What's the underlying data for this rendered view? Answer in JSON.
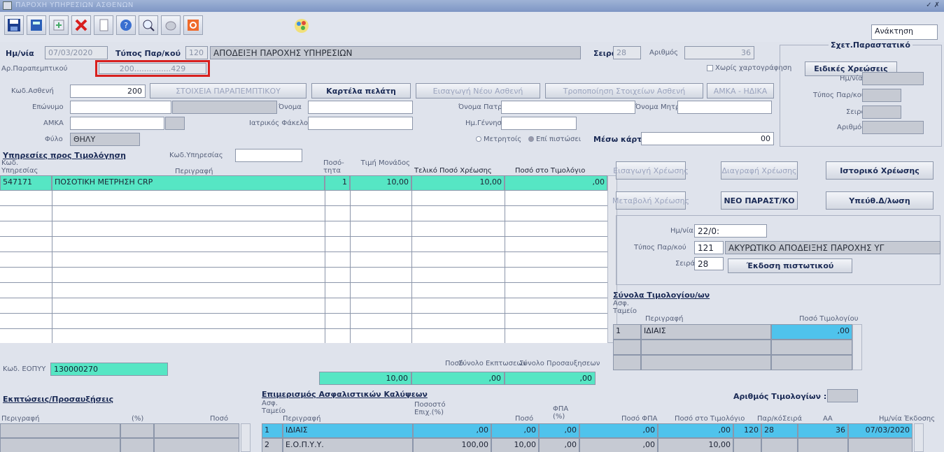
{
  "window": {
    "title": "ΠΑΡΟΧΗ ΥΠΗΡΕΣΙΩΝ ΑΣΘΕΝΩΝ"
  },
  "toolbar": {
    "icons": [
      "save-icon",
      "print-icon",
      "export-icon",
      "delete-icon",
      "new-document-icon",
      "help-icon",
      "zoom-icon",
      "clear-icon",
      "exit-icon",
      "palette-icon"
    ],
    "mode": "Ανάκτηση"
  },
  "header": {
    "date_label": "Ημ/νία",
    "date": "07/03/2020",
    "type_label": "Τύπος Παρ/κού",
    "type_code": "120",
    "type_desc": "ΑΠΟΔΕΙΞΗ ΠΑΡΟΧΗΣ ΥΠΗΡΕΣΙΩΝ",
    "series_label": "Σειρά",
    "series": "28",
    "number_label": "Αριθμός",
    "number": "36",
    "referral_label": "Αρ.Παραπεμπτικού",
    "referral": "200...............429",
    "checkbox_label": "Χωρίς χαρτογράφηση",
    "special_charges": "Ειδικές Χρεώσεις"
  },
  "patient": {
    "code_label": "Κωδ.Ασθενή",
    "code": "200",
    "btn_referral": "ΣΤΟΙΧΕΙΑ ΠΑΡΑΠΕΜΠΤΙΚΟΥ",
    "btn_card": "Καρτέλα πελάτη",
    "btn_new": "Εισαγωγή Νέου Ασθενή",
    "btn_edit": "Τροποποίηση Στοιχείων Ασθενή",
    "btn_amka": "ΑΜΚΑ - ΗΔΙΚΑ",
    "surname_label": "Επώνυμο",
    "name_label": "Όνομα",
    "father_label": "Όνομα Πατρός",
    "mother_label": "Όνομα Μητρός",
    "amka_label": "ΑΜΚΑ",
    "file_label": "Ιατρικός Φάκελος",
    "birth_label": "Ημ.Γέννησης",
    "gender_label": "Φύλο",
    "gender": "ΘΗΛΥ",
    "radio1": "Μετρητοίς",
    "radio2": "Επί πιστώσει",
    "card_label": "Μέσω κάρτας",
    "card_value": "00"
  },
  "related": {
    "title": "Σχετ.Παραστατικό",
    "date_label": "Ημ/νία",
    "type_label": "Τύπος Παρ/κού",
    "series_label": "Σειρά",
    "number_label": "Αριθμός"
  },
  "services": {
    "title": "Υπηρεσίες προς Τιμολόγηση",
    "code_search_label": "Κωδ.Υπηρεσίας",
    "columns": [
      "Κωδ. Υπηρεσίας",
      "Περιγραφή",
      "Ποσό-τητα",
      "Τιμή Μονάδος",
      "Τελικό Ποσό Χρέωσης",
      "Ποσό στο Τιμολόγιο"
    ],
    "rows": [
      {
        "code": "547171",
        "desc": "ΠΟΣΟΤΙΚΗ ΜΕΤΡΗΣΗ CRP",
        "qty": "1",
        "price": "10,00",
        "total": "10,00",
        "invoice": ",00"
      }
    ],
    "eopyy_label": "Κωδ. ΕΟΠΥΥ",
    "eopyy": "130000270",
    "totals_labels": [
      "Ποσό",
      "Σύνολο Εκπτωσεων",
      "Σύνολο Προσαυξησεων"
    ],
    "totals": [
      "10,00",
      ",00",
      ",00"
    ]
  },
  "actions": {
    "b1": "Εισαγωγή Χρέωσης",
    "b2": "Διαγραφή Χρέωσης",
    "b3": "Ιστορικό Χρέωσης",
    "b4": "Μεταβολή Χρέωσης",
    "b5": "ΝΕΟ ΠΑΡΑΣΤ/ΚΟ",
    "b6": "Υπεύθ.Δ/λωση"
  },
  "cancel": {
    "date_label": "Ημ/νία",
    "date": "22/0:",
    "type_label": "Τύπος Παρ/κού",
    "type_code": "121",
    "type_desc": "ΑΚΥΡΩΤΙΚΟ ΑΠΟΔΕΙΞΗΣ ΠΑΡΟΧΗΣ ΥΓ",
    "series_label": "Σειρά",
    "series": "28",
    "issue_btn": "Έκδοση πιστωτικού"
  },
  "invoices": {
    "title": "Σύνολα Τιμολογίου/ων",
    "col1": "Ασφ. Ταμείο",
    "col2": "Περιγραφή",
    "col3": "Ποσό Τιμολογίου",
    "rows": [
      {
        "n": "1",
        "desc": "ΙΔΙΑΙΣ",
        "amount": ",00"
      }
    ]
  },
  "discounts": {
    "title": "Εκπτώσεις/Προσαυξήσεις",
    "cols": [
      "Περιγραφή",
      "(%)",
      "Ποσό"
    ]
  },
  "insurance": {
    "title": "Επιμερισμός Ασφαλιστικών Καλύψεων",
    "invoice_count_label": "Αριθμός Τιμολογίων :",
    "cols": [
      "Ασφ. Ταμείο",
      "Περιγραφή",
      "Ποσοστό Επιχ.(%)",
      "Ποσό",
      "ΦΠΑ (%)",
      "Ποσό ΦΠΑ",
      "Ποσό στο Τιμολόγιο",
      "Παρ/κό",
      "Σειρά",
      "ΑΑ",
      "Ημ/νία Έκδοσης"
    ],
    "rows": [
      {
        "n": "1",
        "desc": "ΙΔΙΑΙΣ",
        "pct": ",00",
        "amt": ",00",
        "vat": ",00",
        "vatamt": ",00",
        "inv": ",00",
        "doc": "120",
        "ser": "28",
        "aa": "36",
        "date": "07/03/2020"
      },
      {
        "n": "2",
        "desc": "Ε.Ο.Π.Υ.Υ.",
        "pct": "100,00",
        "amt": "10,00",
        "vat": ",00",
        "vatamt": ",00",
        "inv": "10,00",
        "doc": "",
        "ser": "",
        "aa": "",
        "date": ""
      }
    ]
  }
}
